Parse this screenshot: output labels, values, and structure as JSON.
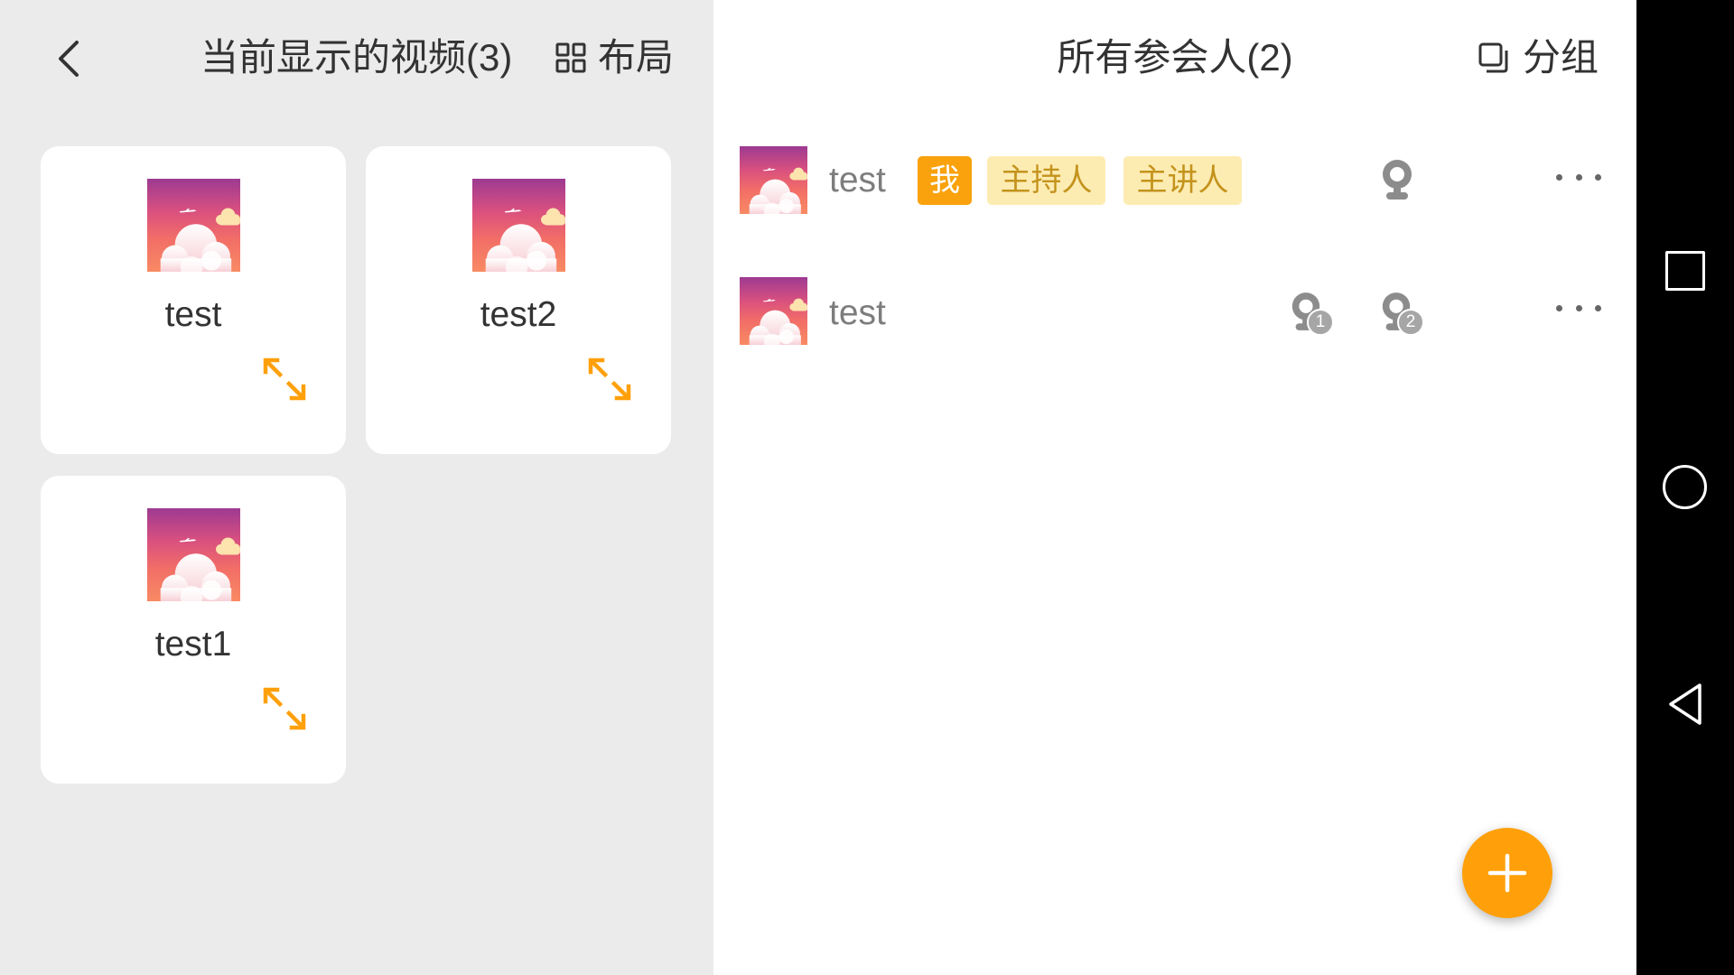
{
  "left_panel": {
    "back_icon": "chevron-left-icon",
    "title": "当前显示的视频(3)",
    "layout_button": {
      "icon": "grid-layout-icon",
      "label": "布局"
    },
    "videos": [
      {
        "name": "test",
        "expand_icon": "expand-icon"
      },
      {
        "name": "test2",
        "expand_icon": "expand-icon"
      },
      {
        "name": "test1",
        "expand_icon": "expand-icon"
      }
    ]
  },
  "right_panel": {
    "title": "所有参会人(2)",
    "group_button": {
      "icon": "group-layers-icon",
      "label": "分组"
    },
    "participants": [
      {
        "name": "test",
        "badges": [
          "我",
          "主持人",
          "主讲人"
        ],
        "devices": [
          {
            "icon": "webcam-icon"
          }
        ],
        "more_icon": "more-horizontal-icon"
      },
      {
        "name": "test",
        "badges": [],
        "devices": [
          {
            "icon": "webcam-icon",
            "number": "1"
          },
          {
            "icon": "webcam-icon",
            "number": "2"
          }
        ],
        "more_icon": "more-horizontal-icon"
      }
    ],
    "add_button": {
      "icon": "plus-icon"
    }
  },
  "system_nav": {
    "items": [
      {
        "icon": "recent-apps-square-icon"
      },
      {
        "icon": "home-circle-icon"
      },
      {
        "icon": "back-triangle-icon"
      }
    ]
  },
  "colors": {
    "accent": "#ffa00a",
    "left_bg": "#ebebeb",
    "badge_me_bg": "#f9a20d",
    "badge_role_bg": "#fdecb2",
    "badge_role_text": "#c4931d",
    "nav_bg": "#000000",
    "icon_grey": "#8c8c8c"
  }
}
